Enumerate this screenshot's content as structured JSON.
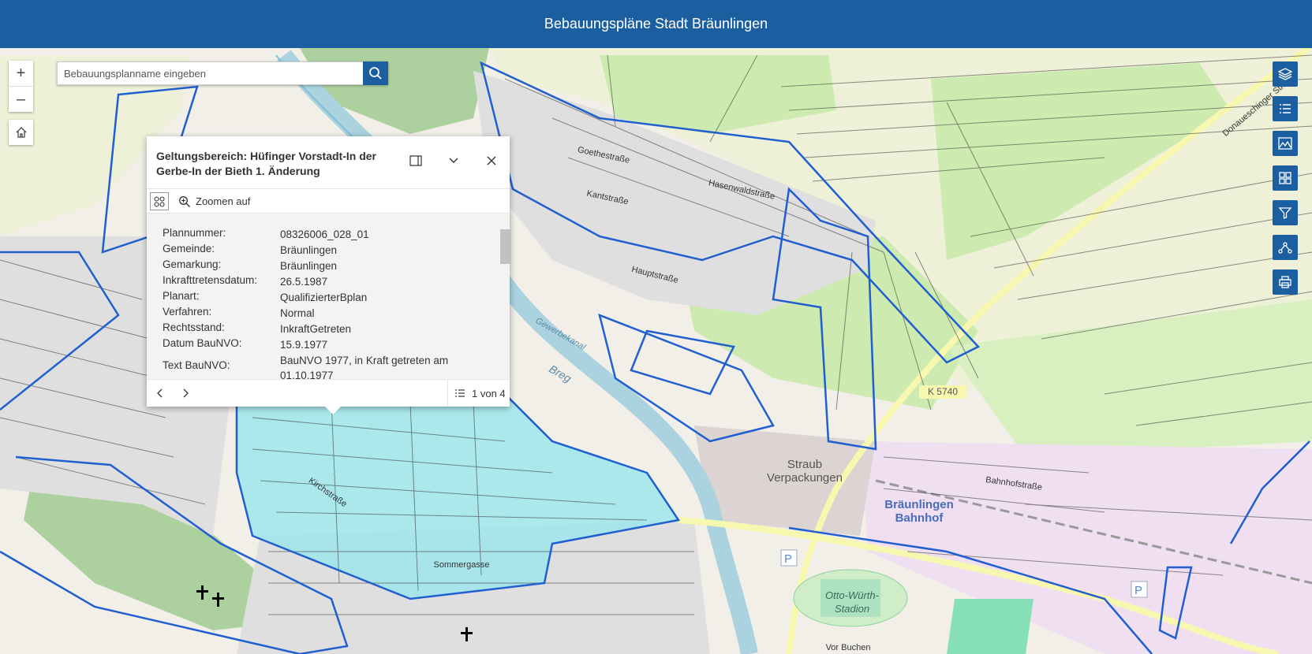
{
  "header": {
    "title": "Bebauungspläne Stadt Bräunlingen"
  },
  "zoom": {
    "in_symbol": "+",
    "out_symbol": "–"
  },
  "search": {
    "placeholder": "Bebauungsplanname eingeben"
  },
  "popup": {
    "title": "Geltungsbereich: Hüfinger Vorstadt-In der Gerbe-In der Bieth 1. Änderung",
    "zoom_to_label": "Zoomen auf",
    "attributes": [
      {
        "label": "Plannummer:",
        "value": "08326006_028_01"
      },
      {
        "label": "Gemeinde:",
        "value": "Bräunlingen"
      },
      {
        "label": "Gemarkung:",
        "value": "Bräunlingen"
      },
      {
        "label": "Inkrafttretensdatum:",
        "value": "26.5.1987"
      },
      {
        "label": "Planart:",
        "value": "QualifizierterBplan"
      },
      {
        "label": "Verfahren:",
        "value": "Normal"
      },
      {
        "label": "Rechtsstand:",
        "value": "InkraftGetreten"
      },
      {
        "label": "Datum BauNVO:",
        "value": "15.9.1977"
      },
      {
        "label": "Text BauNVO:",
        "value": "BauNVO 1977, in Kraft getreten am 01.10.1977"
      }
    ],
    "pager_text": "1 von 4"
  },
  "map": {
    "labels": {
      "straub": "Straub\nVerpackungen",
      "bahnhof": "Bräunlingen\nBahnhof",
      "stadion": "Otto-Würth-\nStadion",
      "k5740": "K 5740",
      "breg": "Breg",
      "gewerbekanal": "Gewerbekanal",
      "vorbuchen": "Vor Buchen",
      "sommergasse": "Sommergasse",
      "bahnhofstrasse": "Bahnhofstraße",
      "kantstrasse": "Kantstraße",
      "goethestrasse": "Goethestraße",
      "hauptstrasse": "Hauptstraße",
      "donaueschinger": "Donaueschinger Str.",
      "hasenwald": "Hasenwaldstraße",
      "kirchstrasse": "Kirchstraße"
    }
  },
  "colors": {
    "header": "#1c5fa0",
    "plan_outline": "#1f5fd0",
    "selected_fill": "#9ee6ec"
  },
  "icons": [
    "plus-icon",
    "minus-icon",
    "home-icon",
    "search-icon",
    "layers-icon",
    "legend-icon",
    "basemap-icon",
    "grid-icon",
    "filter-icon",
    "measure-icon",
    "print-icon",
    "dock-icon",
    "chevron-down-icon",
    "close-icon",
    "select-features-icon",
    "zoom-to-icon",
    "chevron-left-icon",
    "chevron-right-icon",
    "list-icon"
  ]
}
